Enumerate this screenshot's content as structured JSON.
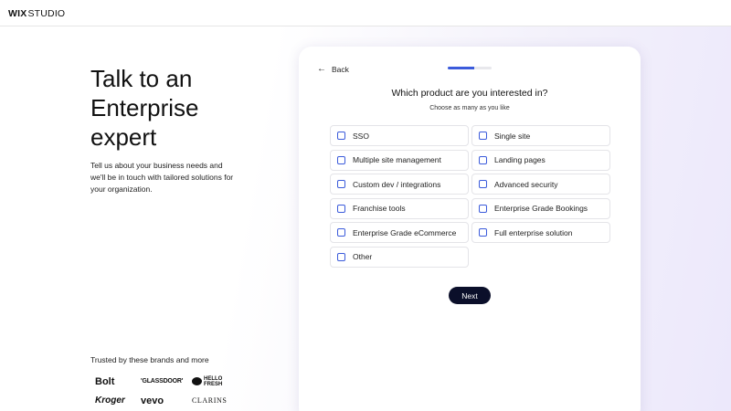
{
  "header": {
    "logo_wix": "WIX",
    "logo_studio": "STUDIO"
  },
  "hero": {
    "title_lines": [
      "Talk to an",
      "Enterprise",
      "expert"
    ],
    "subtitle_lines": [
      "Tell us about your business needs and",
      "we'll be in touch with tailored solutions for",
      "your organization."
    ]
  },
  "trusted": {
    "label": "Trusted by these brands and more",
    "brands": [
      "Bolt",
      "'GLASSDOOR'",
      "HELLO FRESH",
      "Kroger",
      "vevo",
      "CLARINS"
    ],
    "hello_top": "HELLO",
    "hello_bottom": "FRESH"
  },
  "form": {
    "back_label": "Back",
    "progress": 0.6,
    "accent_color": "#3b5bdb",
    "question": "Which product are you interested in?",
    "hint": "Choose as many as you like",
    "options": [
      {
        "label": "SSO",
        "checked": false
      },
      {
        "label": "Single site",
        "checked": false
      },
      {
        "label": "Multiple site management",
        "checked": false
      },
      {
        "label": "Landing pages",
        "checked": false
      },
      {
        "label": "Custom dev / integrations",
        "checked": false
      },
      {
        "label": "Advanced security",
        "checked": false
      },
      {
        "label": "Franchise tools",
        "checked": false
      },
      {
        "label": "Enterprise Grade Bookings",
        "checked": false
      },
      {
        "label": "Enterprise Grade eCommerce",
        "checked": false
      },
      {
        "label": "Full enterprise solution",
        "checked": false
      },
      {
        "label": "Other",
        "checked": false
      }
    ],
    "next_label": "Next"
  }
}
